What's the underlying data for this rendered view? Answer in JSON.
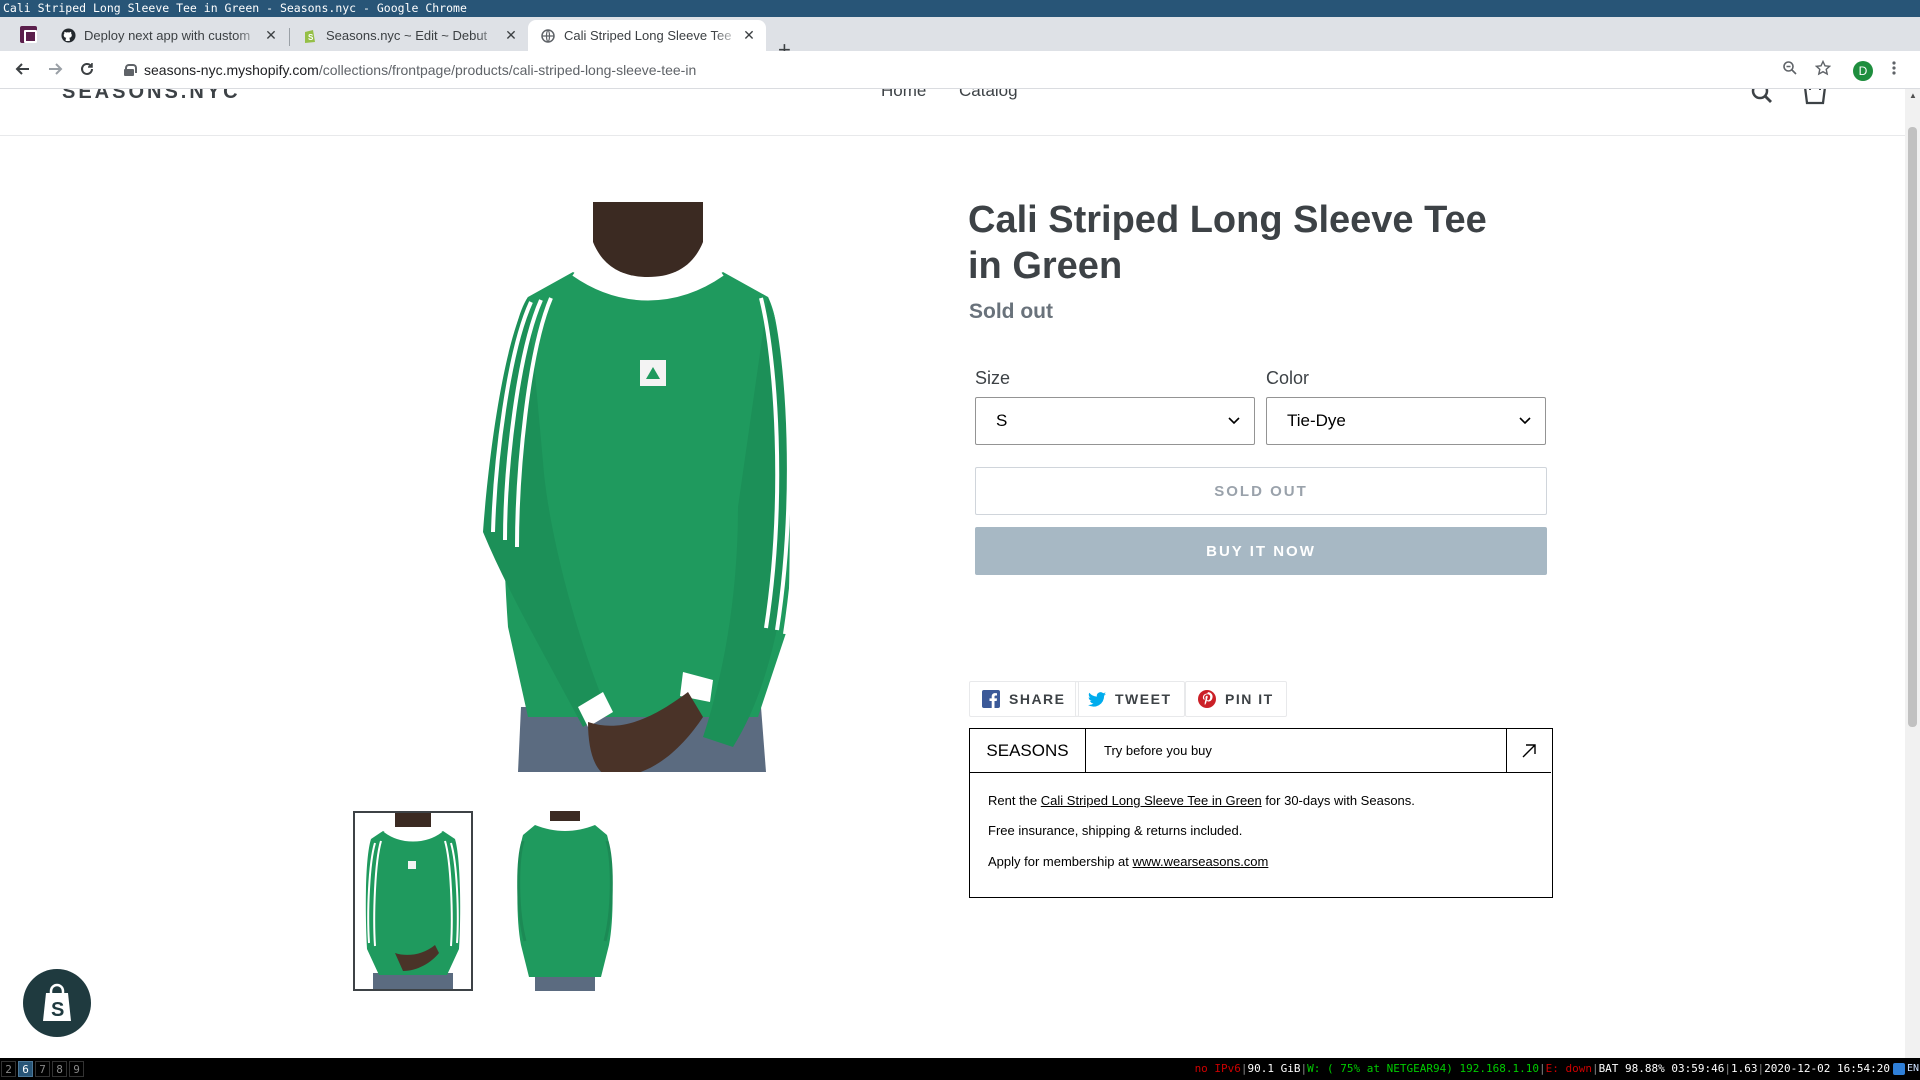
{
  "window_title": "Cali Striped Long Sleeve Tee in Green - Seasons.nyc - Google Chrome",
  "tabs": [
    {
      "label": "Deploy next app with custom",
      "favicon": "github-icon",
      "close": "✕"
    },
    {
      "label": "Seasons.nyc ~ Edit ~ Debut",
      "favicon": "shopify-icon",
      "close": "✕"
    },
    {
      "label": "Cali Striped Long Sleeve Tee",
      "favicon": "globe-icon",
      "close": "✕"
    }
  ],
  "new_tab": "+",
  "url": {
    "host": "seasons-nyc.myshopify.com",
    "path": "/collections/frontpage/products/cali-striped-long-sleeve-tee-in"
  },
  "profile_initial": "D",
  "store": {
    "logo": "SEASONS.NYC",
    "nav": [
      {
        "label": "Home"
      },
      {
        "label": "Catalog"
      }
    ]
  },
  "product": {
    "title": "Cali Striped Long Sleeve Tee in Green",
    "status": "Sold out",
    "size_label": "Size",
    "size_value": "S",
    "color_label": "Color",
    "color_value": "Tie-Dye",
    "sold_out_button": "SOLD OUT",
    "buy_now_button": "BUY IT NOW",
    "shirt_color": "#1f9a5e"
  },
  "share": {
    "facebook": "SHARE",
    "twitter": "TWEET",
    "pinterest": "PIN IT"
  },
  "seasons_widget": {
    "brand": "SEASONS",
    "tagline": "Try before you buy",
    "line1_pre": "Rent the",
    "line1_link": "Cali Striped Long Sleeve Tee in Green",
    "line1_post": "for 30-days with Seasons.",
    "line2": "Free insurance, shipping & returns included.",
    "line3_pre": "Apply for membership at",
    "line3_link": "www.wearseasons.com"
  },
  "statusbar": {
    "workspaces": [
      "2",
      "6",
      "7",
      "8",
      "9"
    ],
    "active_workspace": "6",
    "ipv6": "no IPv6",
    "disk": "90.1 GiB",
    "wifi": "W: ( 75% at NETGEAR94) 192.168.1.10",
    "eth": "E: down",
    "battery": "BAT 98.88% 03:59:46",
    "load": "1.63",
    "datetime": "2020-12-02 16:54:20",
    "lang": "EN"
  }
}
